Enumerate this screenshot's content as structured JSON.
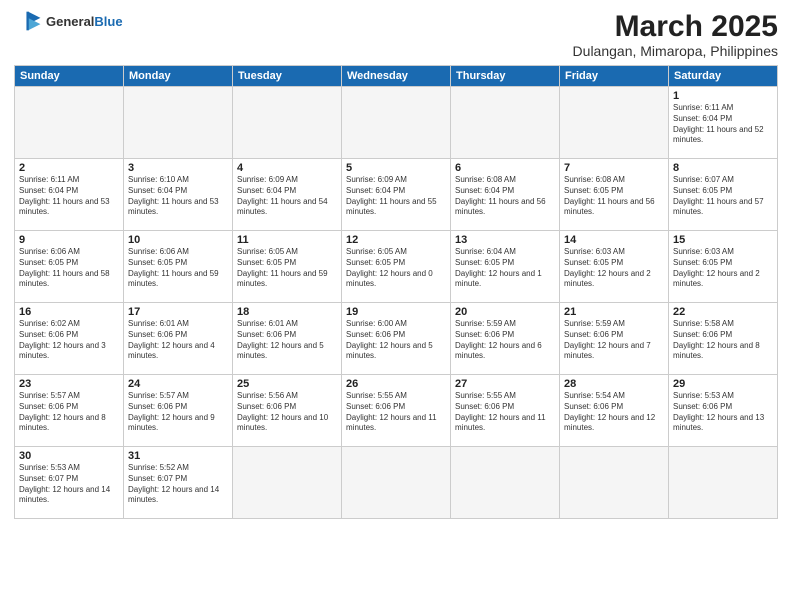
{
  "logo": {
    "line1": "General",
    "line2": "Blue"
  },
  "title": "March 2025",
  "subtitle": "Dulangan, Mimaropa, Philippines",
  "weekdays": [
    "Sunday",
    "Monday",
    "Tuesday",
    "Wednesday",
    "Thursday",
    "Friday",
    "Saturday"
  ],
  "weeks": [
    [
      {
        "day": "",
        "empty": true
      },
      {
        "day": "",
        "empty": true
      },
      {
        "day": "",
        "empty": true
      },
      {
        "day": "",
        "empty": true
      },
      {
        "day": "",
        "empty": true
      },
      {
        "day": "",
        "empty": true
      },
      {
        "day": "1",
        "sunrise": "6:11 AM",
        "sunset": "6:04 PM",
        "daylight": "11 hours and 52 minutes."
      }
    ],
    [
      {
        "day": "2",
        "sunrise": "6:11 AM",
        "sunset": "6:04 PM",
        "daylight": "11 hours and 53 minutes."
      },
      {
        "day": "3",
        "sunrise": "6:10 AM",
        "sunset": "6:04 PM",
        "daylight": "11 hours and 53 minutes."
      },
      {
        "day": "4",
        "sunrise": "6:09 AM",
        "sunset": "6:04 PM",
        "daylight": "11 hours and 54 minutes."
      },
      {
        "day": "5",
        "sunrise": "6:09 AM",
        "sunset": "6:04 PM",
        "daylight": "11 hours and 55 minutes."
      },
      {
        "day": "6",
        "sunrise": "6:08 AM",
        "sunset": "6:04 PM",
        "daylight": "11 hours and 56 minutes."
      },
      {
        "day": "7",
        "sunrise": "6:08 AM",
        "sunset": "6:05 PM",
        "daylight": "11 hours and 56 minutes."
      },
      {
        "day": "8",
        "sunrise": "6:07 AM",
        "sunset": "6:05 PM",
        "daylight": "11 hours and 57 minutes."
      }
    ],
    [
      {
        "day": "9",
        "sunrise": "6:06 AM",
        "sunset": "6:05 PM",
        "daylight": "11 hours and 58 minutes."
      },
      {
        "day": "10",
        "sunrise": "6:06 AM",
        "sunset": "6:05 PM",
        "daylight": "11 hours and 59 minutes."
      },
      {
        "day": "11",
        "sunrise": "6:05 AM",
        "sunset": "6:05 PM",
        "daylight": "11 hours and 59 minutes."
      },
      {
        "day": "12",
        "sunrise": "6:05 AM",
        "sunset": "6:05 PM",
        "daylight": "12 hours and 0 minutes."
      },
      {
        "day": "13",
        "sunrise": "6:04 AM",
        "sunset": "6:05 PM",
        "daylight": "12 hours and 1 minute."
      },
      {
        "day": "14",
        "sunrise": "6:03 AM",
        "sunset": "6:05 PM",
        "daylight": "12 hours and 2 minutes."
      },
      {
        "day": "15",
        "sunrise": "6:03 AM",
        "sunset": "6:05 PM",
        "daylight": "12 hours and 2 minutes."
      }
    ],
    [
      {
        "day": "16",
        "sunrise": "6:02 AM",
        "sunset": "6:06 PM",
        "daylight": "12 hours and 3 minutes."
      },
      {
        "day": "17",
        "sunrise": "6:01 AM",
        "sunset": "6:06 PM",
        "daylight": "12 hours and 4 minutes."
      },
      {
        "day": "18",
        "sunrise": "6:01 AM",
        "sunset": "6:06 PM",
        "daylight": "12 hours and 5 minutes."
      },
      {
        "day": "19",
        "sunrise": "6:00 AM",
        "sunset": "6:06 PM",
        "daylight": "12 hours and 5 minutes."
      },
      {
        "day": "20",
        "sunrise": "5:59 AM",
        "sunset": "6:06 PM",
        "daylight": "12 hours and 6 minutes."
      },
      {
        "day": "21",
        "sunrise": "5:59 AM",
        "sunset": "6:06 PM",
        "daylight": "12 hours and 7 minutes."
      },
      {
        "day": "22",
        "sunrise": "5:58 AM",
        "sunset": "6:06 PM",
        "daylight": "12 hours and 8 minutes."
      }
    ],
    [
      {
        "day": "23",
        "sunrise": "5:57 AM",
        "sunset": "6:06 PM",
        "daylight": "12 hours and 8 minutes."
      },
      {
        "day": "24",
        "sunrise": "5:57 AM",
        "sunset": "6:06 PM",
        "daylight": "12 hours and 9 minutes."
      },
      {
        "day": "25",
        "sunrise": "5:56 AM",
        "sunset": "6:06 PM",
        "daylight": "12 hours and 10 minutes."
      },
      {
        "day": "26",
        "sunrise": "5:55 AM",
        "sunset": "6:06 PM",
        "daylight": "12 hours and 11 minutes."
      },
      {
        "day": "27",
        "sunrise": "5:55 AM",
        "sunset": "6:06 PM",
        "daylight": "12 hours and 11 minutes."
      },
      {
        "day": "28",
        "sunrise": "5:54 AM",
        "sunset": "6:06 PM",
        "daylight": "12 hours and 12 minutes."
      },
      {
        "day": "29",
        "sunrise": "5:53 AM",
        "sunset": "6:06 PM",
        "daylight": "12 hours and 13 minutes."
      }
    ],
    [
      {
        "day": "30",
        "sunrise": "5:53 AM",
        "sunset": "6:07 PM",
        "daylight": "12 hours and 14 minutes."
      },
      {
        "day": "31",
        "sunrise": "5:52 AM",
        "sunset": "6:07 PM",
        "daylight": "12 hours and 14 minutes."
      },
      {
        "day": "",
        "empty": true
      },
      {
        "day": "",
        "empty": true
      },
      {
        "day": "",
        "empty": true
      },
      {
        "day": "",
        "empty": true
      },
      {
        "day": "",
        "empty": true
      }
    ]
  ]
}
